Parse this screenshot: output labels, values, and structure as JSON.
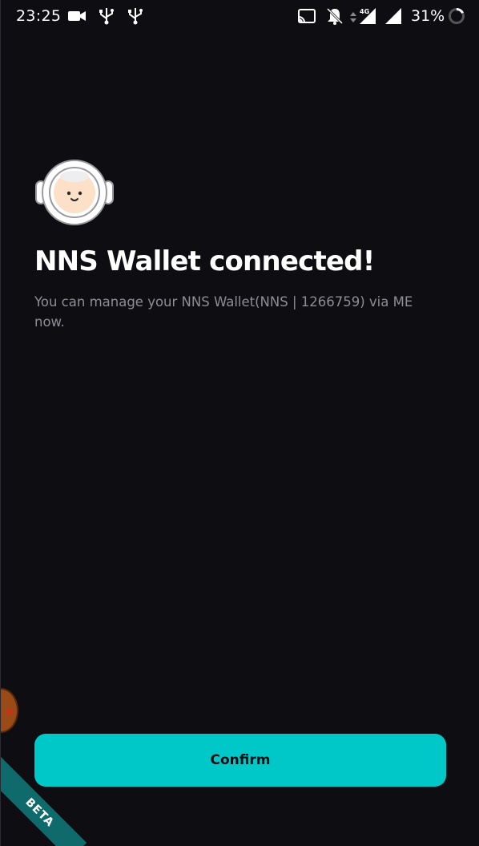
{
  "status_bar": {
    "time": "23:25",
    "network_label": "4G",
    "battery_percent": "31%",
    "icons": [
      "video-camera-icon",
      "usb-icon",
      "usb-icon",
      "cast-icon",
      "notifications-off-icon",
      "data-arrows-icon",
      "signal-4g-icon",
      "signal-icon",
      "battery-ring-icon"
    ]
  },
  "main": {
    "avatar_icon": "astronaut-avatar-icon",
    "title": "NNS Wallet connected!",
    "subtitle": "You can manage your NNS Wallet(NNS | 1266759) via ME now."
  },
  "actions": {
    "confirm_label": "Confirm"
  },
  "ribbon": {
    "beta_label": "BETA"
  },
  "colors": {
    "background": "#0e0d12",
    "accent": "#00c8c8",
    "ribbon": "#0f6b6b",
    "subtitle": "#8e8d93"
  }
}
